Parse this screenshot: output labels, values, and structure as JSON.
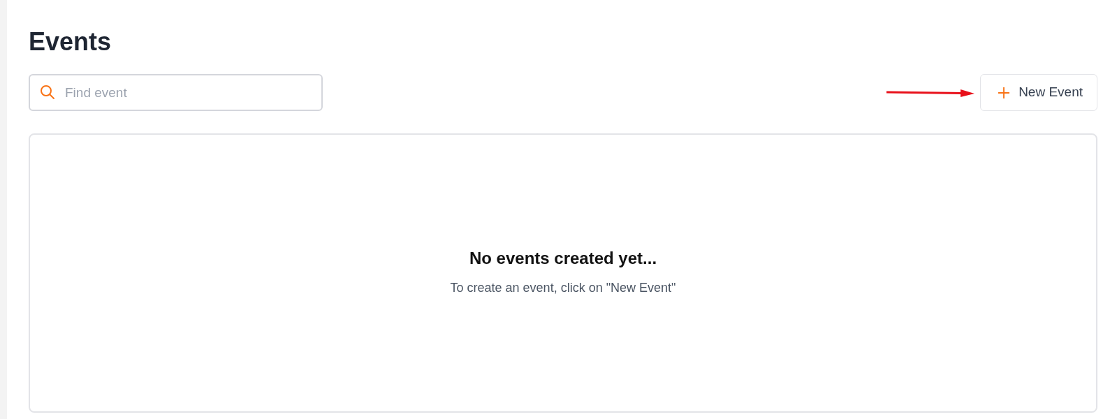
{
  "title": "Events",
  "search": {
    "placeholder": "Find event"
  },
  "new_button": {
    "label": "New Event"
  },
  "empty_state": {
    "heading": "No events created yet...",
    "message": "To create an event, click on \"New Event\""
  }
}
